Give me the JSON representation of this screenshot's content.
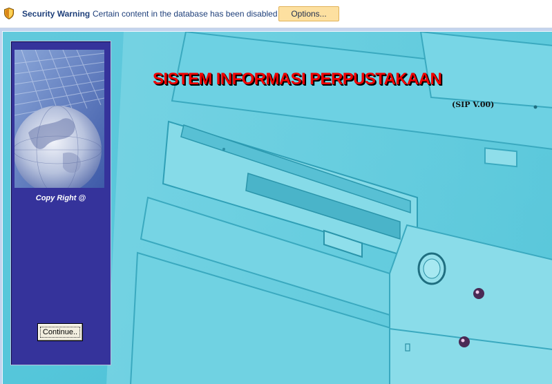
{
  "security_bar": {
    "title": "Security Warning",
    "message": "Certain content in the database has been disabled",
    "options_label": "Options..."
  },
  "main": {
    "title": "SISTEM INFORMASI PERPUSTAKAAN",
    "subtitle": "(SIP V.00)"
  },
  "side_panel": {
    "copyright": "Copy Right @",
    "continue_label": "Continue.."
  },
  "colors": {
    "title_red": "#f00000",
    "panel_blue": "#35339b",
    "background_cyan": "#5ccddf",
    "options_button": "#fde0a0",
    "warning_text": "#1e3f7a"
  },
  "icons": {
    "security": "shield-warning-icon"
  }
}
